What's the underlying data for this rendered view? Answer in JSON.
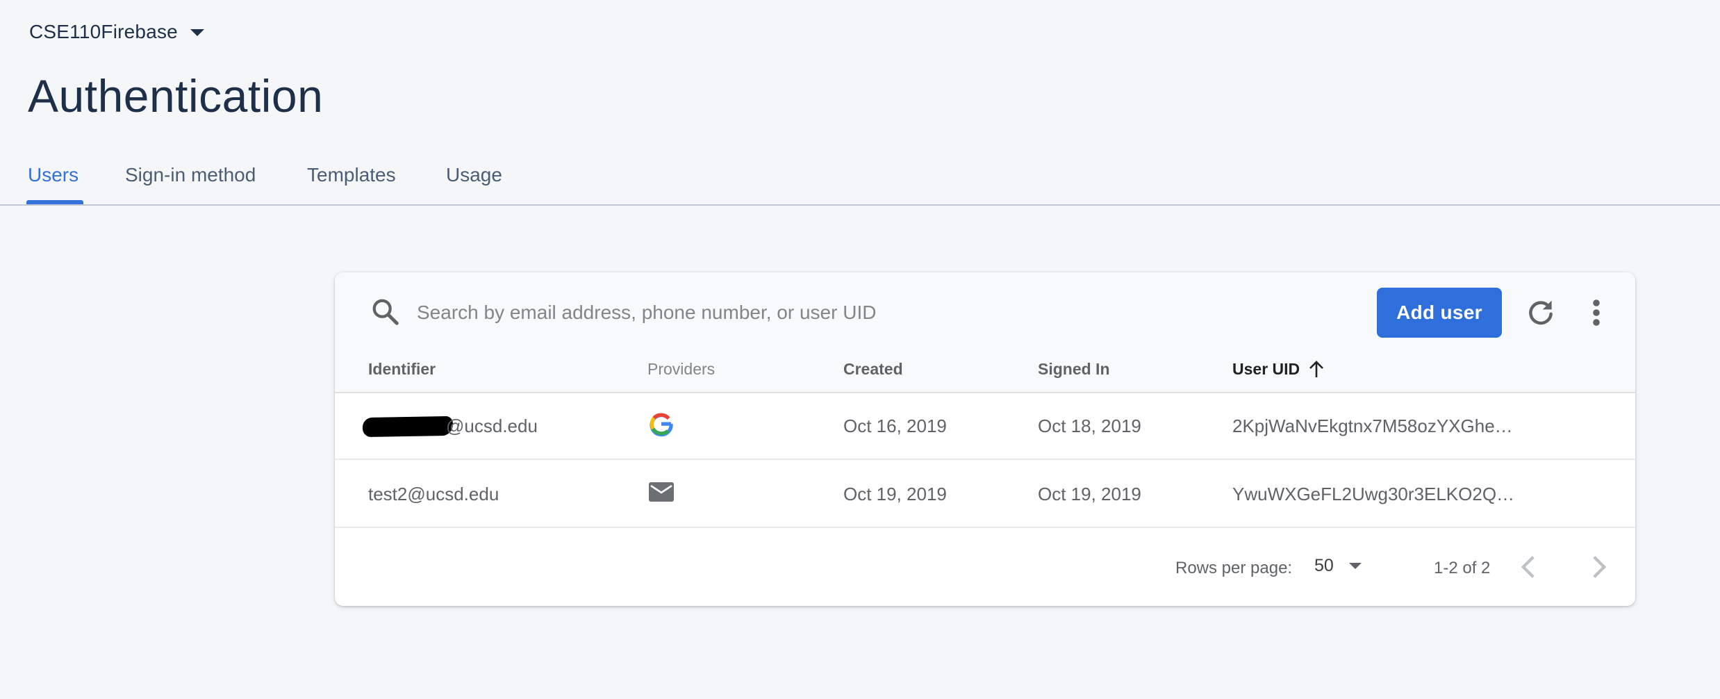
{
  "header": {
    "project_name": "CSE110Firebase",
    "page_title": "Authentication"
  },
  "tabs": [
    {
      "label": "Users",
      "active": true
    },
    {
      "label": "Sign-in method",
      "active": false
    },
    {
      "label": "Templates",
      "active": false
    },
    {
      "label": "Usage",
      "active": false
    }
  ],
  "toolbar": {
    "search_placeholder": "Search by email address, phone number, or user UID",
    "add_user_label": "Add user"
  },
  "table": {
    "columns": [
      "Identifier",
      "Providers",
      "Created",
      "Signed In",
      "User UID"
    ],
    "sorted_column": "User UID",
    "rows": [
      {
        "identifier": "@ucsd.edu",
        "provider": "google-icon",
        "created": "Oct 16, 2019",
        "signed_in": "Oct 18, 2019",
        "uid": "2KpjWaNvEkgtnx7M58ozYXGhe5y2"
      },
      {
        "identifier": "test2@ucsd.edu",
        "provider": "email-icon",
        "created": "Oct 19, 2019",
        "signed_in": "Oct 19, 2019",
        "uid": "YwuWXGeFL2Uwg30r3ELKO2QeJ…"
      }
    ]
  },
  "pagination": {
    "rows_per_page_label": "Rows per page:",
    "rows_per_page_value": "50",
    "range": "1-2 of 2"
  },
  "colors": {
    "accent": "#3471d8",
    "button": "#2f6fdc",
    "title": "#1e2f4a"
  }
}
